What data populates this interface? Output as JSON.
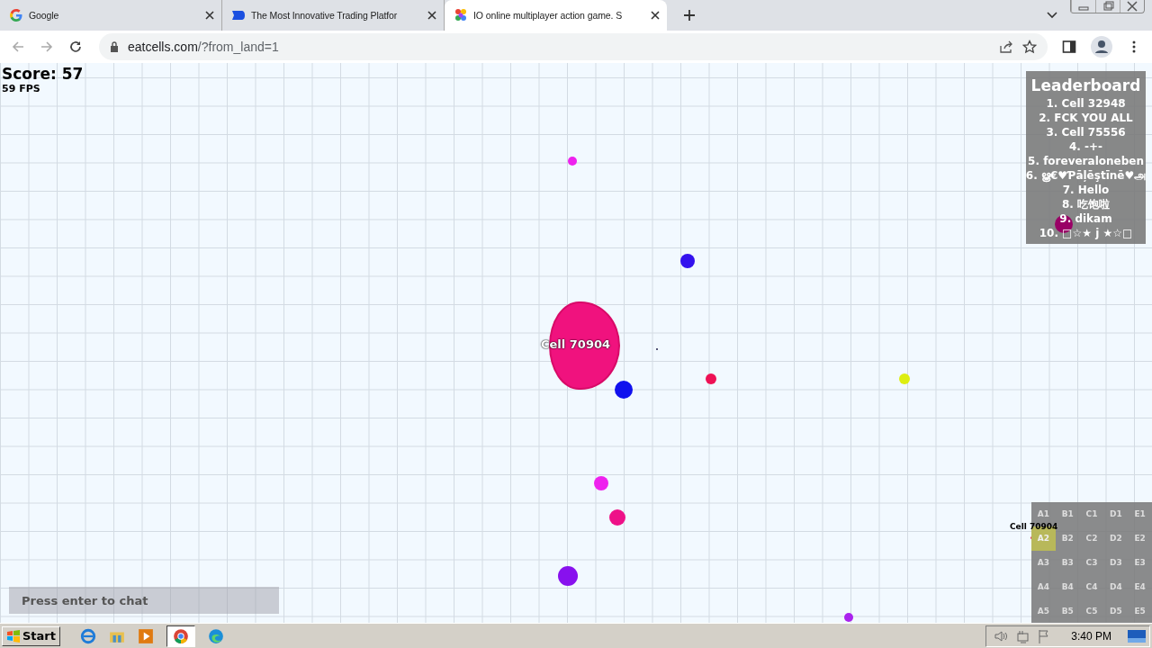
{
  "tabs": [
    {
      "title": "Google",
      "selected": false
    },
    {
      "title": "The Most Innovative Trading Platfor",
      "selected": false
    },
    {
      "title": "IO online multiplayer action game. S",
      "selected": true
    }
  ],
  "address_bar": {
    "url_host": "eatcells.com",
    "url_path": "/?from_land=1"
  },
  "game": {
    "score": "Score: 57",
    "fps": "59 FPS",
    "player": {
      "name": "Cell 70904",
      "color": "#f0127e"
    },
    "pellets": [
      {
        "color": "#ee22ee"
      },
      {
        "color": "#3311ee"
      },
      {
        "color": "#ee1155"
      },
      {
        "color": "#ddee11"
      },
      {
        "color": "#1111ee"
      },
      {
        "color": "#ee22ee"
      },
      {
        "color": "#ee1188"
      },
      {
        "color": "#8811ee"
      },
      {
        "color": "#aa22ee"
      },
      {
        "color": "#990066"
      }
    ],
    "leaderboard": {
      "title": "Leaderboard",
      "entries": [
        "1. Cell 32948",
        "2. FCK YOU ALL",
        "3. Cell 75556",
        "4. -+-",
        "5. foreveraloneben",
        "6. ൠ€♥Ƥāļēştīnē♥அ",
        "7. Hello",
        "8. 吃饱啦",
        "9. dikam",
        "10. □☆★ j ★☆□"
      ]
    },
    "minimap": {
      "player_label": "Cell 70904",
      "sectors": [
        {
          "label": "A1",
          "selected": false
        },
        {
          "label": "B1",
          "selected": false
        },
        {
          "label": "C1",
          "selected": false
        },
        {
          "label": "D1",
          "selected": false
        },
        {
          "label": "E1",
          "selected": false
        },
        {
          "label": "A2",
          "selected": true
        },
        {
          "label": "B2",
          "selected": false
        },
        {
          "label": "C2",
          "selected": false
        },
        {
          "label": "D2",
          "selected": false
        },
        {
          "label": "E2",
          "selected": false
        },
        {
          "label": "A3",
          "selected": false
        },
        {
          "label": "B3",
          "selected": false
        },
        {
          "label": "C3",
          "selected": false
        },
        {
          "label": "D3",
          "selected": false
        },
        {
          "label": "E3",
          "selected": false
        },
        {
          "label": "A4",
          "selected": false
        },
        {
          "label": "B4",
          "selected": false
        },
        {
          "label": "C4",
          "selected": false
        },
        {
          "label": "D4",
          "selected": false
        },
        {
          "label": "E4",
          "selected": false
        },
        {
          "label": "A5",
          "selected": false
        },
        {
          "label": "B5",
          "selected": false
        },
        {
          "label": "C5",
          "selected": false
        },
        {
          "label": "D5",
          "selected": false
        },
        {
          "label": "E5",
          "selected": false
        }
      ]
    },
    "chat": {
      "placeholder": "Press enter to chat"
    }
  },
  "taskbar": {
    "start": "Start",
    "clock": "3:40 PM"
  }
}
